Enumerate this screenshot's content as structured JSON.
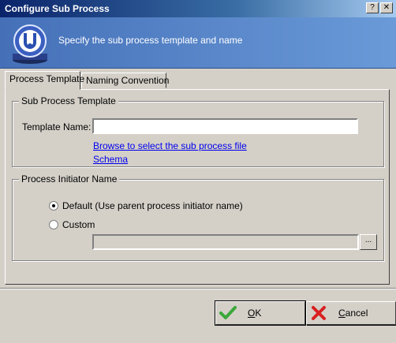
{
  "window": {
    "title": "Configure Sub Process",
    "controls": {
      "help": "?",
      "close": "✕"
    }
  },
  "banner": {
    "text": "Specify the sub process template and name",
    "icon": "process-globe-icon"
  },
  "tabs": [
    {
      "label": "Process Template",
      "active": true
    },
    {
      "label": "Naming Convention",
      "active": false
    }
  ],
  "sub_process_template": {
    "group_title": "Sub Process Template",
    "template_name_label": "Template Name:",
    "template_name_value": "",
    "browse_link": "Browse to select the sub process file",
    "schema_link": "Schema"
  },
  "process_initiator": {
    "group_title": "Process Initiator Name",
    "options": [
      {
        "label": "Default (Use parent process initiator name)",
        "checked": true
      },
      {
        "label": "Custom",
        "checked": false
      }
    ],
    "custom_value": "",
    "browse_button": "..."
  },
  "buttons": {
    "ok": "OK",
    "cancel": "Cancel"
  },
  "colors": {
    "title_bar": "#0a246a",
    "banner": "#4a78c0",
    "link": "#0000ee",
    "ok_check": "#3aa83a",
    "cancel_x": "#d82020"
  }
}
